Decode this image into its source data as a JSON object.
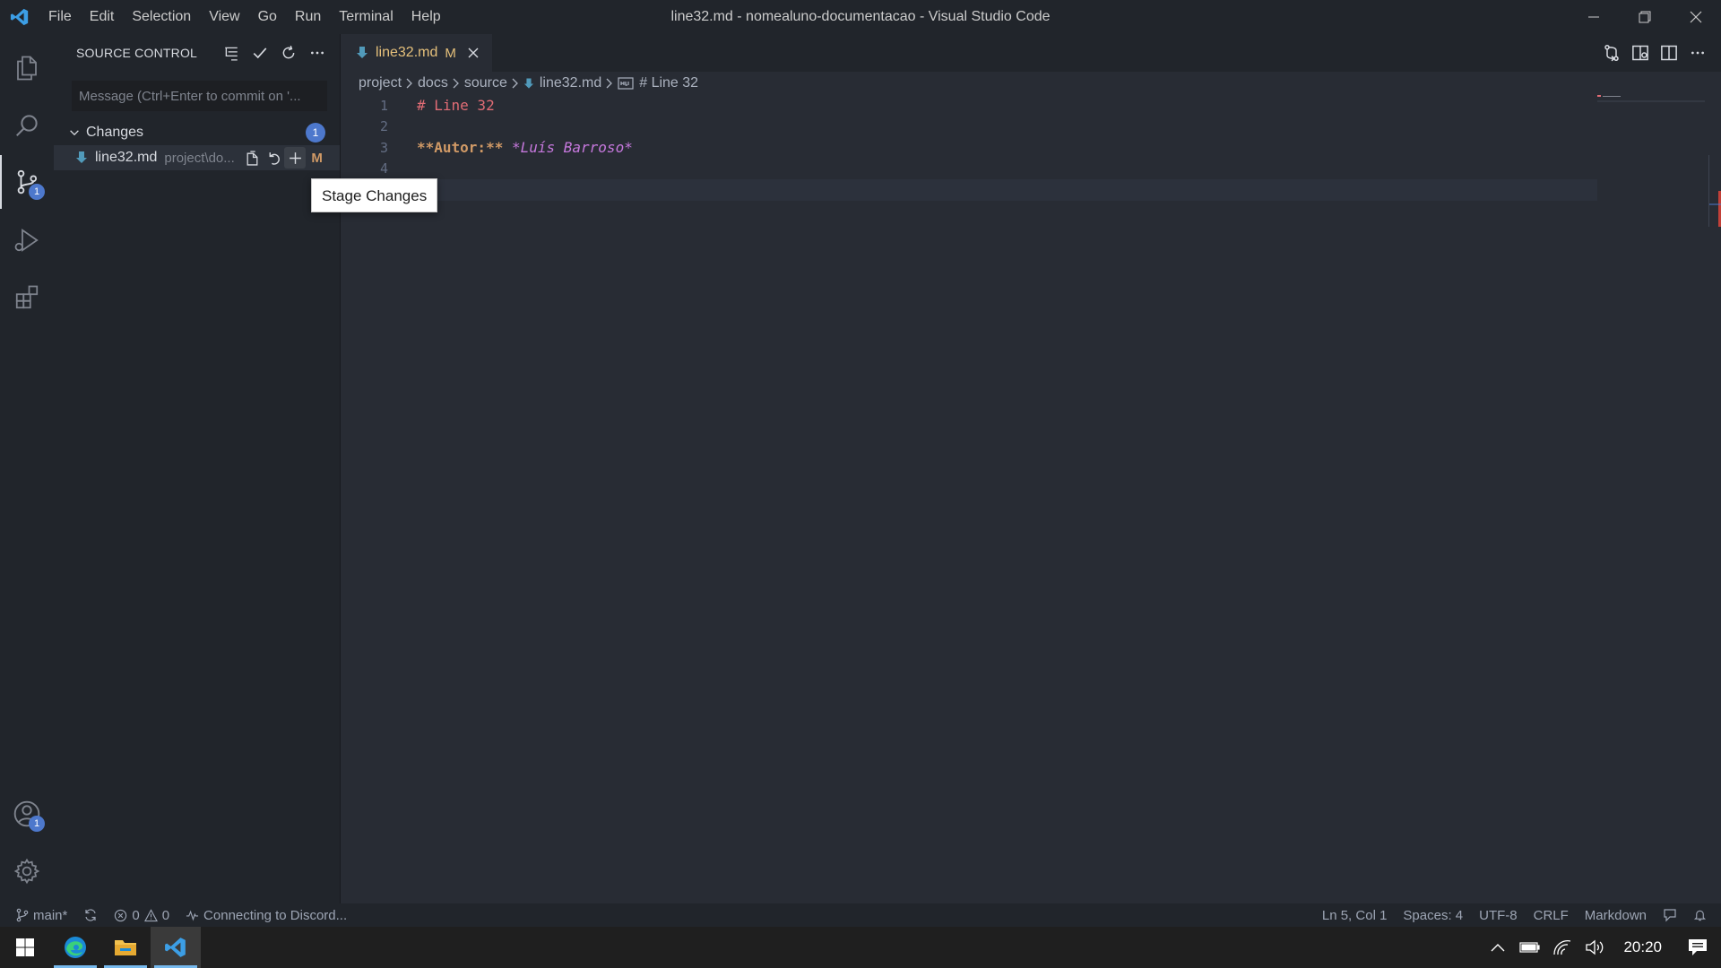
{
  "window": {
    "title": "line32.md - nomealuno-documentacao - Visual Studio Code",
    "menu": [
      "File",
      "Edit",
      "Selection",
      "View",
      "Go",
      "Run",
      "Terminal",
      "Help"
    ]
  },
  "activity_bar": {
    "scm_badge": "1",
    "accounts_badge": "1"
  },
  "sidebar": {
    "title": "SOURCE CONTROL",
    "commit_placeholder": "Message (Ctrl+Enter to commit on '...",
    "group_label": "Changes",
    "group_count": "1",
    "file": {
      "name": "line32.md",
      "path": "project\\do...",
      "status": "M"
    },
    "tooltip": "Stage Changes"
  },
  "editor": {
    "tab": {
      "name": "line32.md",
      "modified": "M"
    },
    "breadcrumb": [
      "project",
      "docs",
      "source",
      "line32.md",
      "# Line 32"
    ],
    "lines": [
      {
        "no": "1",
        "heading": "# Line 32"
      },
      {
        "no": "2"
      },
      {
        "no": "3",
        "bold": "**Autor:**",
        "italic": "*Luís Barroso*"
      },
      {
        "no": "4"
      },
      {
        "no": "5"
      }
    ]
  },
  "statusbar": {
    "branch": "main*",
    "errors": "0",
    "warnings": "0",
    "discord": "Connecting to Discord...",
    "position": "Ln 5, Col 1",
    "spaces": "Spaces: 4",
    "encoding": "UTF-8",
    "eol": "CRLF",
    "language": "Markdown"
  },
  "taskbar": {
    "time": "20:20"
  },
  "colors": {
    "accent": "#4d78cc",
    "modified": "#e5c07b",
    "heading": "#e06c75",
    "bold": "#d19a66",
    "italic": "#c678dd"
  }
}
